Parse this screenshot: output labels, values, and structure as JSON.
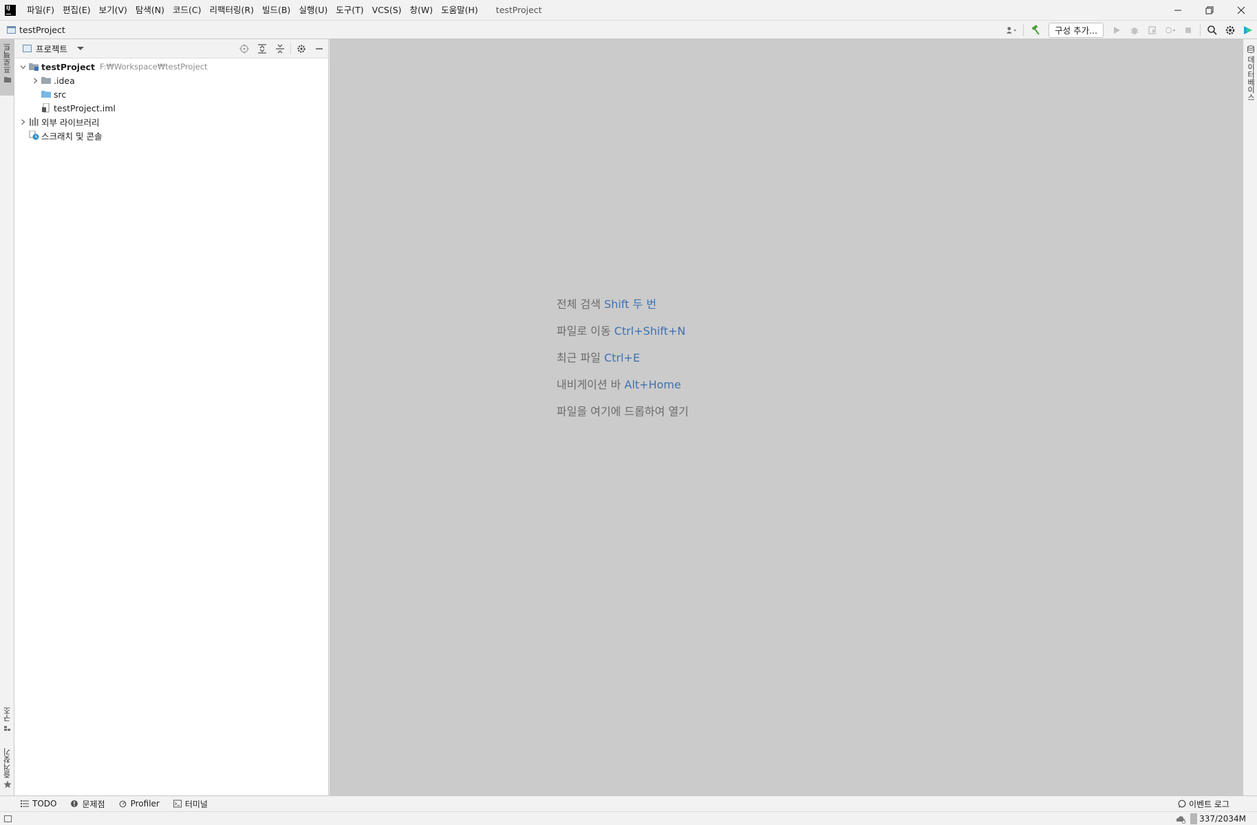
{
  "menubar": {
    "items": [
      "파일(F)",
      "편집(E)",
      "보기(V)",
      "탐색(N)",
      "코드(C)",
      "리팩터링(R)",
      "빌드(B)",
      "실행(U)",
      "도구(T)",
      "VCS(S)",
      "창(W)",
      "도움말(H)"
    ],
    "window_title": "testProject"
  },
  "navbar": {
    "breadcrumb": "testProject",
    "config_button": "구성 추가..."
  },
  "left_stripe": {
    "project_tab": "프로젝트",
    "structure_tab": "구조",
    "favorites_tab": "즐겨찾기"
  },
  "right_stripe": {
    "database_tab": "데이터베이스"
  },
  "project_panel": {
    "title": "프로젝트",
    "tree": {
      "root_name": "testProject",
      "root_path": "F:₩Workspace₩testProject",
      "idea": ".idea",
      "src": "src",
      "iml": "testProject.iml",
      "ext_libs": "외부 라이브러리",
      "scratches": "스크래치 및 콘솔"
    }
  },
  "editor": {
    "hints": [
      {
        "text": "전체 검색",
        "key": "Shift 두 번"
      },
      {
        "text": "파일로 이동",
        "key": "Ctrl+Shift+N"
      },
      {
        "text": "최근 파일",
        "key": "Ctrl+E"
      },
      {
        "text": "내비게이션 바",
        "key": "Alt+Home"
      },
      {
        "text": "파일을 여기에 드롭하여 열기",
        "key": ""
      }
    ]
  },
  "bottom_tools": {
    "todo": "TODO",
    "problems": "문제점",
    "profiler": "Profiler",
    "terminal": "터미널",
    "event_log": "이벤트 로그"
  },
  "statusbar": {
    "memory": "337/2034M"
  },
  "colors": {
    "accent_key": "#3e72b0",
    "editor_bg": "#cbcbcb",
    "chrome_bg": "#f2f2f2"
  }
}
